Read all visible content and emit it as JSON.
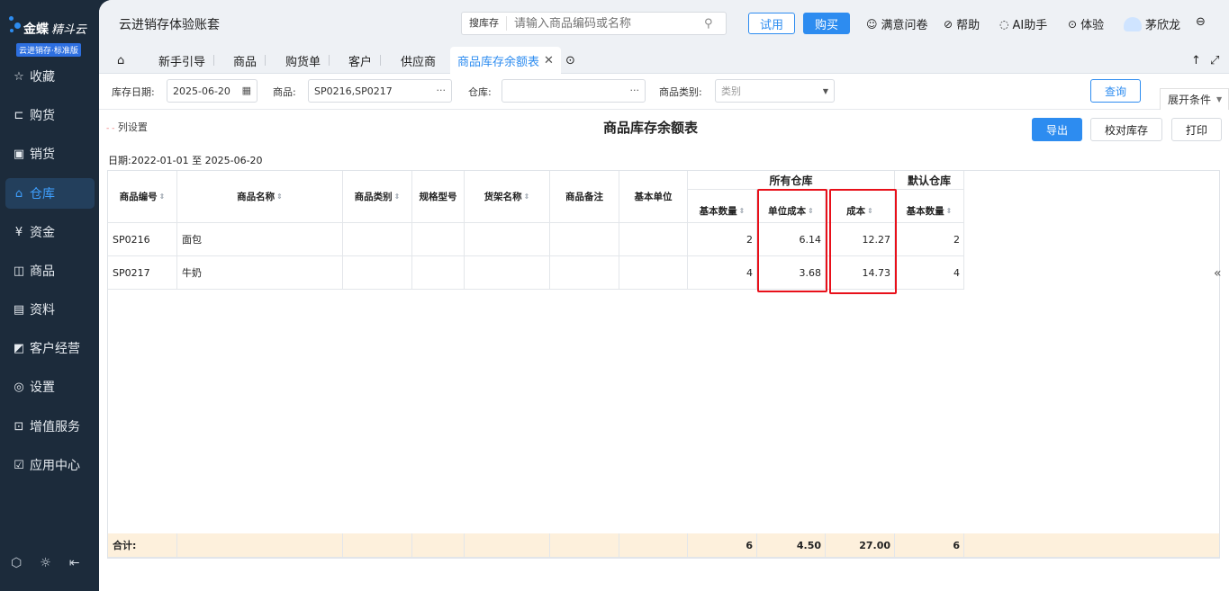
{
  "sidebar": {
    "brand_main": "金蝶",
    "brand_sub": "精斗云",
    "edition": "云进销存·标准版",
    "items": [
      {
        "label": "收藏",
        "icon": "star-icon"
      },
      {
        "label": "购货",
        "icon": "cart-icon"
      },
      {
        "label": "销货",
        "icon": "sales-icon"
      },
      {
        "label": "仓库",
        "icon": "warehouse-icon"
      },
      {
        "label": "资金",
        "icon": "money-icon"
      },
      {
        "label": "商品",
        "icon": "goods-icon"
      },
      {
        "label": "资料",
        "icon": "document-icon"
      },
      {
        "label": "客户经营",
        "icon": "chart-icon"
      },
      {
        "label": "设置",
        "icon": "settings-icon"
      },
      {
        "label": "增值服务",
        "icon": "service-icon"
      },
      {
        "label": "应用中心",
        "icon": "app-center-icon"
      }
    ]
  },
  "header": {
    "account": "云进销存体验账套",
    "search_scope": "搜库存",
    "search_placeholder": "请输入商品编码或名称",
    "trial": "试用",
    "buy": "购买",
    "survey": "满意问卷",
    "help": "帮助",
    "ai": "AI助手",
    "experience": "体验",
    "user": "茅欣龙"
  },
  "tabs": [
    "新手引导",
    "商品",
    "购货单",
    "客户",
    "供应商",
    "商品库存余额表"
  ],
  "filters": {
    "date_label": "库存日期:",
    "date_value": "2025-06-20",
    "goods_label": "商品:",
    "goods_value": "SP0216,SP0217",
    "warehouse_label": "仓库:",
    "warehouse_value": "",
    "category_label": "商品类别:",
    "category_placeholder": "类别",
    "query": "查询",
    "expand": "展开条件"
  },
  "report": {
    "title": "商品库存余额表",
    "column_settings": "列设置",
    "export": "导出",
    "check_stock": "校对库存",
    "print": "打印",
    "date_range": "日期:2022-01-01 至 2025-06-20",
    "headers": {
      "code": "商品编号",
      "name": "商品名称",
      "category": "商品类别",
      "spec": "规格型号",
      "shelf": "货架名称",
      "remark": "商品备注",
      "unit": "基本单位",
      "all_wh": "所有仓库",
      "default_wh": "默认仓库",
      "qty": "基本数量",
      "unit_cost": "单位成本",
      "cost": "成本",
      "dqty": "基本数量"
    },
    "rows": [
      {
        "code": "SP0216",
        "name": "面包",
        "qty": "2",
        "unit_cost": "6.14",
        "cost": "12.27",
        "dqty": "2"
      },
      {
        "code": "SP0217",
        "name": "牛奶",
        "qty": "4",
        "unit_cost": "3.68",
        "cost": "14.73",
        "dqty": "4"
      }
    ],
    "total": {
      "label": "合计:",
      "qty": "6",
      "unit_cost": "4.50",
      "cost": "27.00",
      "dqty": "6"
    }
  }
}
